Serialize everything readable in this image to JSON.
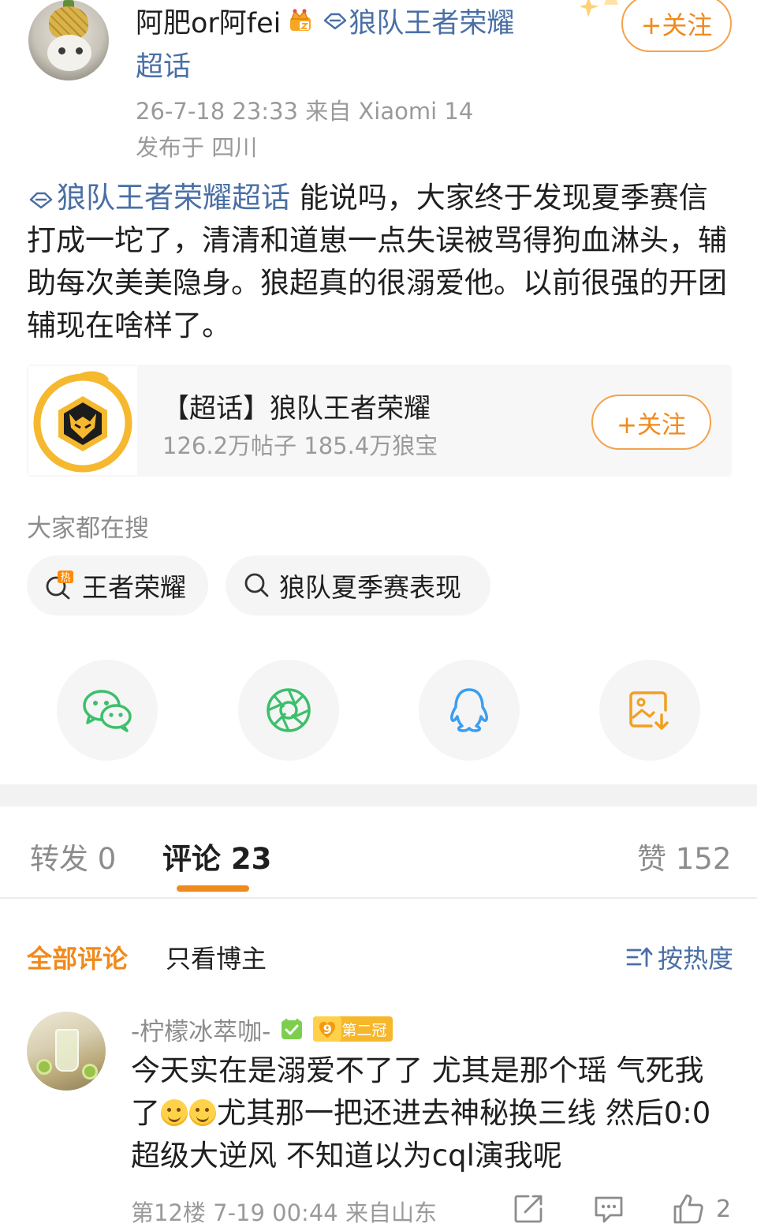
{
  "post": {
    "author": {
      "name": "阿肥or阿fei",
      "topic_line1": "狼队王者荣耀",
      "topic_line2": "超话",
      "follow_label": "+关注"
    },
    "meta": {
      "time_source": "26-7-18 23:33   来自 Xiaomi 14",
      "location": "发布于 四川"
    },
    "body": {
      "topic_tag": "狼队王者荣耀超话",
      "text": " 能说吗，大家终于发现夏季赛信打成一坨了，清清和道崽一点失误被骂得狗血淋头，辅助每次美美隐身。狼超真的很溺爱他。以前很强的开团辅现在啥样了。"
    },
    "topic_card": {
      "title": "【超话】狼队王者荣耀",
      "stats": "126.2万帖子 185.4万狼宝",
      "follow_label": "+关注"
    }
  },
  "search": {
    "heading": "大家都在搜",
    "chips": [
      {
        "label": "王者荣耀",
        "icon": "hot-search-icon",
        "badge": "热"
      },
      {
        "label": "狼队夏季赛表现",
        "icon": "search-icon"
      }
    ]
  },
  "share": {
    "icons": [
      "wechat-icon",
      "moments-icon",
      "qq-icon",
      "save-image-icon"
    ],
    "colors": {
      "wechat": "#3cbf6b",
      "moments": "#3cbf6b",
      "qq": "#3a9ef0",
      "save": "#f0a020"
    }
  },
  "tabs": {
    "repost": "转发 0",
    "comments": "评论 23",
    "likes": "赞 152"
  },
  "filters": {
    "all": "全部评论",
    "op_only": "只看博主",
    "sort": "按热度"
  },
  "comment": {
    "user": "-柠檬冰萃咖-",
    "fan_level": "9",
    "fan_title": "第二冠",
    "text_part1": "今天实在是溺爱不了了 尤其是那个瑶 气死我了",
    "text_part2": "尤其那一把还进去神秘换三线 然后0:0超级大逆风 不知道以为cql演我呢",
    "meta": "第12楼 7-19 00:44 来自山东",
    "like_count": "2"
  },
  "colors": {
    "accent": "#f08a1d",
    "link": "#4a6fa5",
    "muted": "#9a9a9a"
  }
}
